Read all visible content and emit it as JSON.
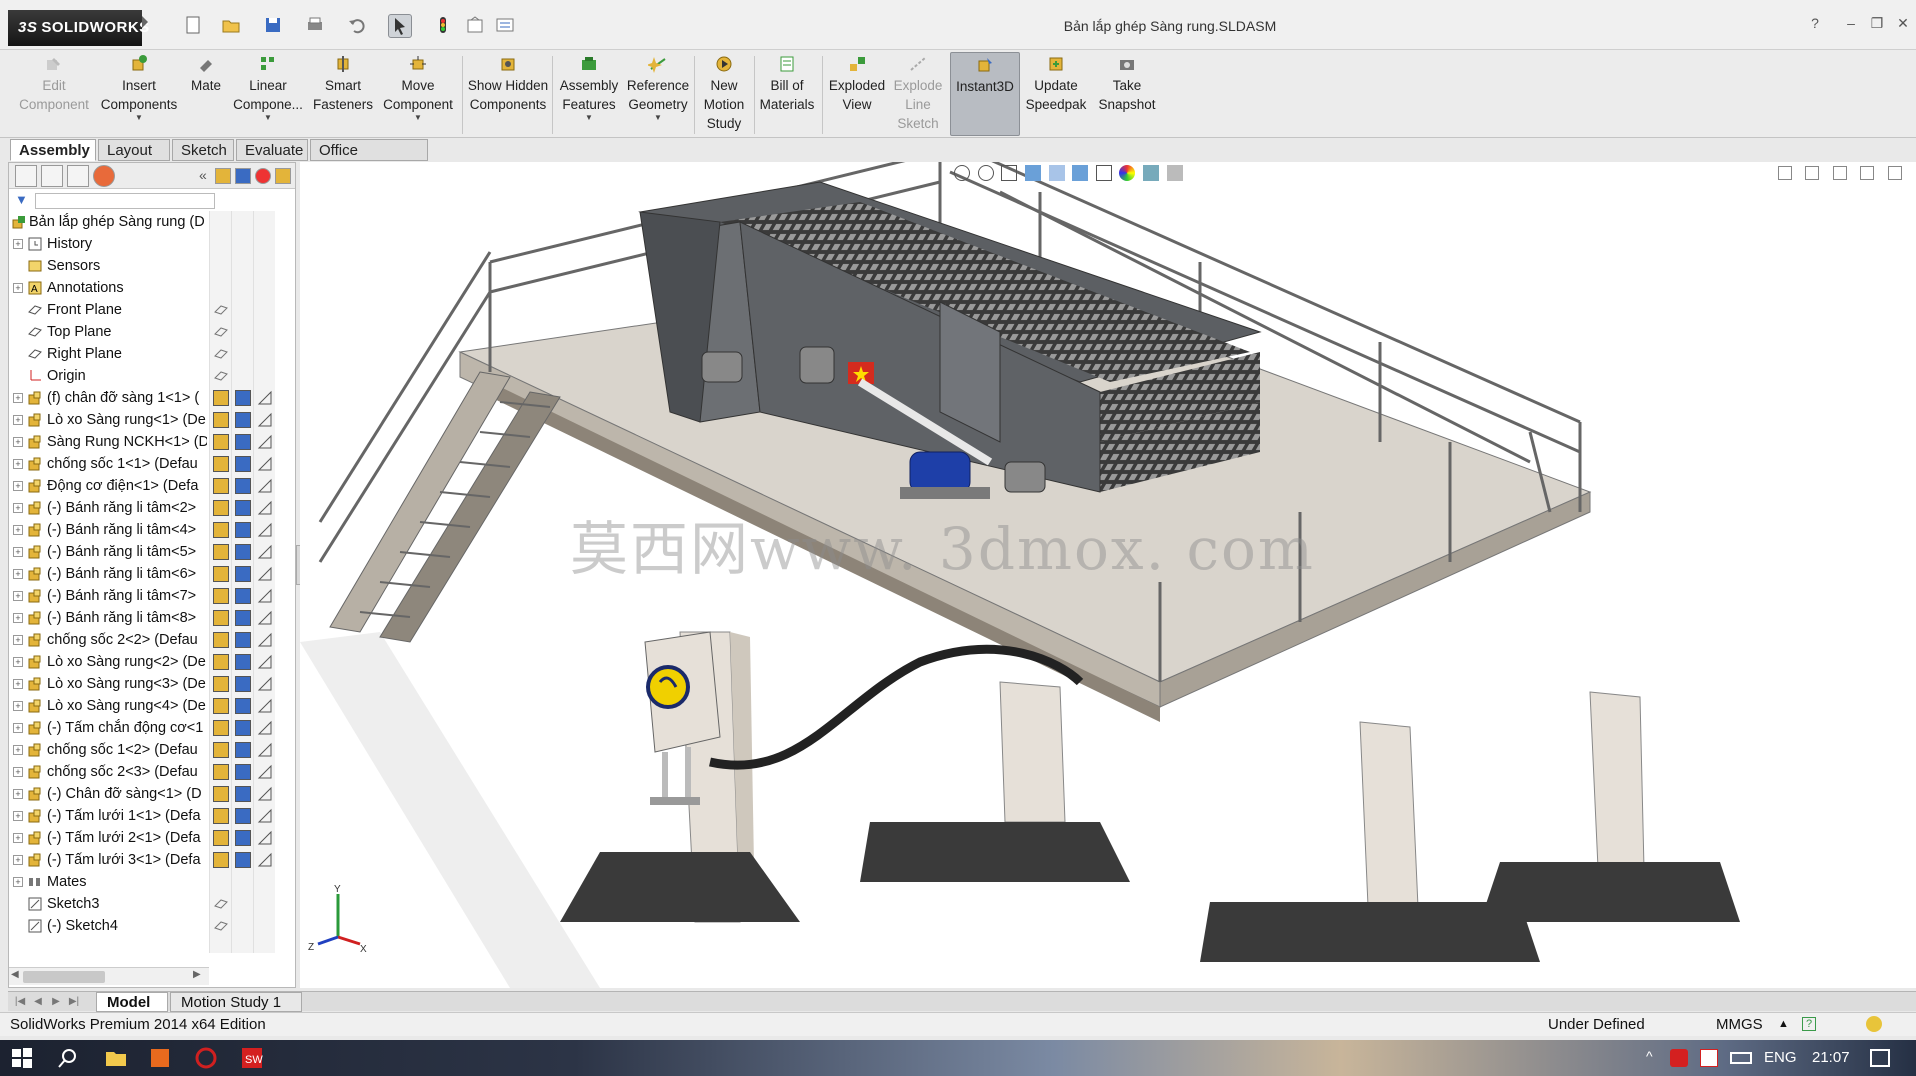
{
  "app": {
    "name": "SOLIDWORKS",
    "document_title": "Bản lắp ghép Sàng rung.SLDASM"
  },
  "ribbon": {
    "buttons": [
      {
        "label": "Edit Component",
        "icon": "edit-component-icon",
        "state": "disabled"
      },
      {
        "label": "Insert Components",
        "icon": "insert-components-icon",
        "state": "normal"
      },
      {
        "label": "Mate",
        "icon": "mate-icon",
        "state": "normal"
      },
      {
        "label": "Linear Compone...",
        "icon": "linear-pattern-icon",
        "state": "normal"
      },
      {
        "label": "Smart Fasteners",
        "icon": "smart-fasteners-icon",
        "state": "normal"
      },
      {
        "label": "Move Component",
        "icon": "move-component-icon",
        "state": "normal"
      },
      {
        "label": "Show Hidden Components",
        "icon": "show-hidden-icon",
        "state": "normal"
      },
      {
        "label": "Assembly Features",
        "icon": "assembly-features-icon",
        "state": "normal"
      },
      {
        "label": "Reference Geometry",
        "icon": "reference-geometry-icon",
        "state": "normal"
      },
      {
        "label": "New Motion Study",
        "icon": "motion-study-icon",
        "state": "normal"
      },
      {
        "label": "Bill of Materials",
        "icon": "bom-icon",
        "state": "normal"
      },
      {
        "label": "Exploded View",
        "icon": "exploded-view-icon",
        "state": "normal"
      },
      {
        "label": "Explode Line Sketch",
        "icon": "explode-line-icon",
        "state": "disabled"
      },
      {
        "label": "Instant3D",
        "icon": "instant3d-icon",
        "state": "active"
      },
      {
        "label": "Update Speedpak",
        "icon": "speedpak-icon",
        "state": "normal"
      },
      {
        "label": "Take Snapshot",
        "icon": "snapshot-icon",
        "state": "normal"
      }
    ]
  },
  "command_tabs": [
    "Assembly",
    "Layout",
    "Sketch",
    "Evaluate",
    "Office Products"
  ],
  "tree": {
    "root": "Bản lắp ghép Sàng rung (D",
    "items": [
      {
        "label": "History",
        "icon": "history-icon",
        "expandable": true
      },
      {
        "label": "Sensors",
        "icon": "sensors-icon",
        "expandable": false
      },
      {
        "label": "Annotations",
        "icon": "annotations-icon",
        "expandable": true
      },
      {
        "label": "Front Plane",
        "icon": "plane-icon",
        "expandable": false
      },
      {
        "label": "Top Plane",
        "icon": "plane-icon",
        "expandable": false
      },
      {
        "label": "Right Plane",
        "icon": "plane-icon",
        "expandable": false
      },
      {
        "label": "Origin",
        "icon": "origin-icon",
        "expandable": false
      },
      {
        "label": "(f) chân đỡ sàng 1<1> (",
        "icon": "component-icon",
        "expandable": true
      },
      {
        "label": "Lò xo Sàng rung<1> (De",
        "icon": "component-icon",
        "expandable": true
      },
      {
        "label": "Sàng Rung NCKH<1> (D",
        "icon": "component-icon",
        "expandable": true
      },
      {
        "label": "chống sốc 1<1> (Defau",
        "icon": "component-icon",
        "expandable": true
      },
      {
        "label": "Động cơ điện<1> (Defa",
        "icon": "component-icon",
        "expandable": true
      },
      {
        "label": "(-) Bánh răng li tâm<2>",
        "icon": "component-icon",
        "expandable": true
      },
      {
        "label": "(-) Bánh răng li tâm<4>",
        "icon": "component-icon",
        "expandable": true
      },
      {
        "label": "(-) Bánh răng li tâm<5>",
        "icon": "component-icon",
        "expandable": true
      },
      {
        "label": "(-) Bánh răng li tâm<6>",
        "icon": "component-icon",
        "expandable": true
      },
      {
        "label": "(-) Bánh răng li tâm<7>",
        "icon": "component-icon",
        "expandable": true
      },
      {
        "label": "(-) Bánh răng li tâm<8>",
        "icon": "component-icon",
        "expandable": true
      },
      {
        "label": "chống sốc 2<2> (Defau",
        "icon": "component-icon",
        "expandable": true
      },
      {
        "label": "Lò xo Sàng rung<2> (De",
        "icon": "component-icon",
        "expandable": true
      },
      {
        "label": "Lò xo Sàng rung<3> (De",
        "icon": "component-icon",
        "expandable": true
      },
      {
        "label": "Lò xo Sàng rung<4> (De",
        "icon": "component-icon",
        "expandable": true
      },
      {
        "label": "(-) Tấm chắn động cơ<1",
        "icon": "component-icon",
        "expandable": true
      },
      {
        "label": "chống sốc 1<2> (Defau",
        "icon": "component-icon",
        "expandable": true
      },
      {
        "label": "chống sốc 2<3> (Defau",
        "icon": "component-icon",
        "expandable": true
      },
      {
        "label": "(-) Chân đỡ sàng<1> (D",
        "icon": "component-icon",
        "expandable": true
      },
      {
        "label": "(-) Tấm lưới 1<1> (Defa",
        "icon": "component-icon",
        "expandable": true
      },
      {
        "label": "(-) Tấm lưới 2<1> (Defa",
        "icon": "component-icon",
        "expandable": true
      },
      {
        "label": "(-) Tấm lưới 3<1> (Defa",
        "icon": "component-icon",
        "expandable": true
      },
      {
        "label": "Mates",
        "icon": "mates-icon",
        "expandable": true
      },
      {
        "label": "Sketch3",
        "icon": "sketch-icon",
        "expandable": false
      },
      {
        "label": "(-) Sketch4",
        "icon": "sketch-icon",
        "expandable": false
      }
    ]
  },
  "viewport": {
    "watermark": "莫西网www. 3dmox. com",
    "triad_axes": [
      "Y",
      "Z",
      "X"
    ]
  },
  "bottom_tabs": [
    "Model",
    "Motion Study 1"
  ],
  "status": {
    "edition": "SolidWorks Premium 2014 x64 Edition",
    "definition": "Under Defined",
    "units": "MMGS"
  },
  "taskbar": {
    "language": "ENG",
    "time": "21:07"
  },
  "colors": {
    "accent_active": "#b8bcc2",
    "platform": "#d9d4cc",
    "frame_steel": "#6c6f73",
    "mesh": "#2a2a2a",
    "motor_blue": "#1e3fa8"
  }
}
